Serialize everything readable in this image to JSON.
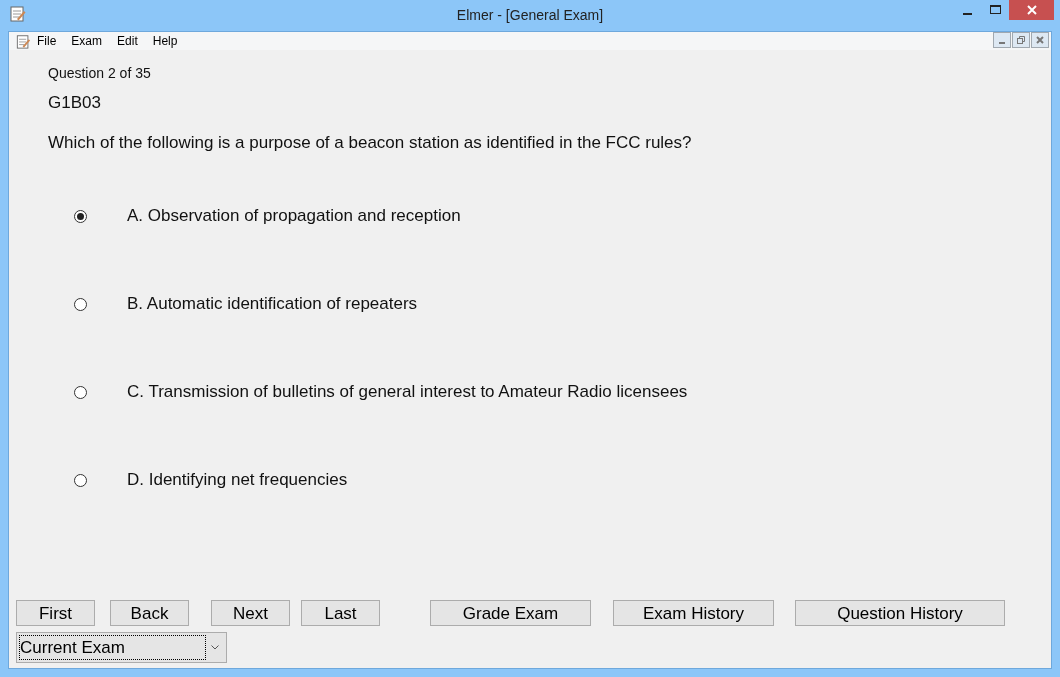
{
  "window": {
    "title": "Elmer - [General Exam]"
  },
  "menu": [
    "File",
    "Exam",
    "Edit",
    "Help"
  ],
  "question": {
    "counter": "Question 2 of 35",
    "id": "G1B03",
    "text": "Which of the following is a purpose of a beacon station as identified in the FCC rules?"
  },
  "answers": [
    {
      "label": "A. Observation of propagation and reception",
      "selected": true
    },
    {
      "label": "B. Automatic identification of repeaters",
      "selected": false
    },
    {
      "label": "C. Transmission of bulletins of general interest to Amateur Radio licensees",
      "selected": false
    },
    {
      "label": "D. Identifying net frequencies",
      "selected": false
    }
  ],
  "nav_buttons": [
    "First",
    "Back",
    "Next",
    "Last"
  ],
  "action_buttons": [
    "Grade Exam",
    "Exam History",
    "Question History"
  ],
  "exam_select": {
    "value": "Current Exam"
  }
}
